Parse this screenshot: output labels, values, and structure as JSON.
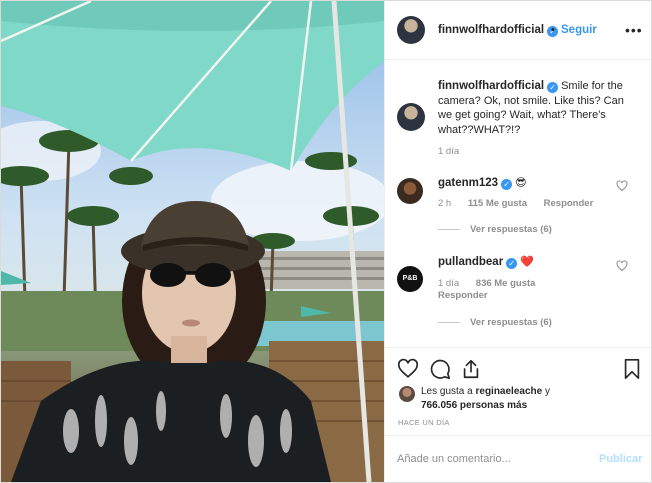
{
  "post": {
    "username": "finnwolfhardofficial",
    "follow_label": "Seguir",
    "caption": "Smile for the camera? Ok, not smile. Like this? Can we get going? Wait, what? There's what??WHAT?!?",
    "caption_time": "1 día"
  },
  "comments": [
    {
      "username": "gatenm123",
      "emoji": "😎",
      "time": "2 h",
      "likes": "115 Me gusta",
      "reply_label": "Responder",
      "view_replies": "Ver respuestas (6)"
    },
    {
      "username": "pullandbear",
      "emoji": "❤️",
      "avatar_text": "P&B",
      "time": "1 día",
      "likes": "836 Me gusta",
      "reply_label": "Responder",
      "view_replies": "Ver respuestas (6)"
    }
  ],
  "likes": {
    "prefix": "Les gusta a ",
    "user": "reginaeleache",
    "joiner": " y",
    "count": "766.056 personas más"
  },
  "time_ago": "HACE UN DÍA",
  "add_comment": {
    "placeholder": "Añade un comentario...",
    "publish_label": "Publicar"
  },
  "icons": {
    "more": "more-options-icon",
    "like": "heart-icon",
    "comment": "comment-icon",
    "share": "share-icon",
    "save": "bookmark-icon",
    "verified": "verified-badge-icon"
  },
  "colors": {
    "accent": "#3897f0",
    "publish_disabled": "#b2dffc",
    "secondary_text": "#8e8e8e",
    "umbrella": "#7fd8c8"
  }
}
